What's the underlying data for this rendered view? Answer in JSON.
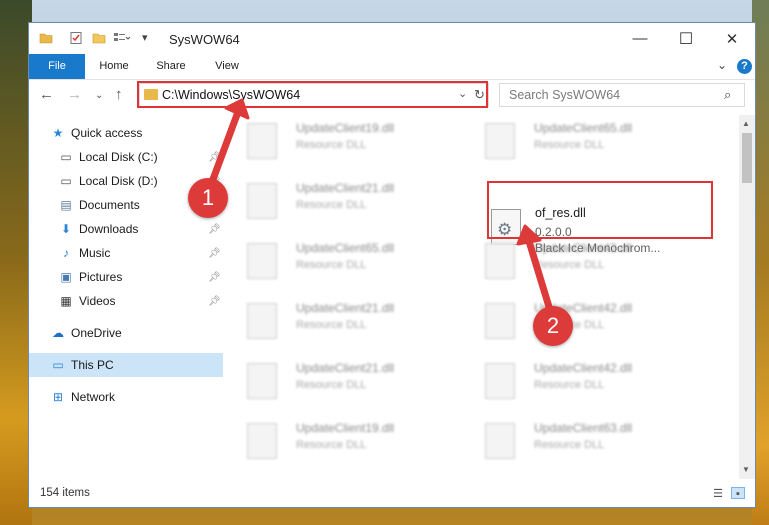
{
  "window": {
    "title": "SysWOW64",
    "minimize_glyph": "—",
    "maximize_glyph": "☐",
    "close_glyph": "✕"
  },
  "ribbon": {
    "tabs": [
      "File",
      "Home",
      "Share",
      "View"
    ],
    "help_glyph": "?"
  },
  "nav": {
    "address": "C:\\Windows\\SysWOW64",
    "search_placeholder": "Search SysWOW64"
  },
  "sidebar": {
    "items": [
      {
        "label": "Quick access",
        "icon": "star-icon",
        "pinned": false
      },
      {
        "label": "Local Disk (C:)",
        "icon": "drive-icon",
        "pinned": true
      },
      {
        "label": "Local Disk (D:)",
        "icon": "drive-icon",
        "pinned": true
      },
      {
        "label": "Documents",
        "icon": "document-icon",
        "pinned": true
      },
      {
        "label": "Downloads",
        "icon": "download-icon",
        "pinned": true
      },
      {
        "label": "Music",
        "icon": "music-icon",
        "pinned": true
      },
      {
        "label": "Pictures",
        "icon": "picture-icon",
        "pinned": true
      },
      {
        "label": "Videos",
        "icon": "video-icon",
        "pinned": true
      },
      {
        "label": "OneDrive",
        "icon": "cloud-icon",
        "pinned": false
      },
      {
        "label": "This PC",
        "icon": "computer-icon",
        "pinned": false,
        "selected": true
      },
      {
        "label": "Network",
        "icon": "network-icon",
        "pinned": false
      }
    ]
  },
  "files": {
    "left_column": [
      {
        "name": "UpdateClient19.dll",
        "desc": "Resource DLL"
      },
      {
        "name": "UpdateClient21.dll",
        "desc": "Resource DLL"
      },
      {
        "name": "UpdateClient65.dll",
        "desc": "Resource DLL"
      },
      {
        "name": "UpdateClient21.dll",
        "desc": "Resource DLL"
      },
      {
        "name": "UpdateClient21.dll",
        "desc": "Resource DLL"
      },
      {
        "name": "UpdateClient19.dll",
        "desc": "Resource DLL"
      }
    ],
    "right_column": [
      {
        "name": "UpdateClient65.dll",
        "desc": "Resource DLL"
      },
      {
        "name": "UpdateClient42.dll",
        "desc": "Resource DLL"
      },
      {
        "name": "UpdateClient42.dll",
        "desc": "Resource DLL"
      },
      {
        "name": "UpdateClient42.dll",
        "desc": "Resource DLL"
      },
      {
        "name": "UpdateClient63.dll",
        "desc": "Resource DLL"
      }
    ],
    "highlighted": {
      "name": "of_res.dll",
      "version": "0.2.0.0",
      "description": "Black Ice Monochrom..."
    }
  },
  "status": {
    "item_count": "154 items"
  },
  "callouts": [
    "1",
    "2"
  ],
  "colors": {
    "accent": "#1979ca",
    "highlight": "#e03434",
    "selection": "#cce4f7"
  }
}
